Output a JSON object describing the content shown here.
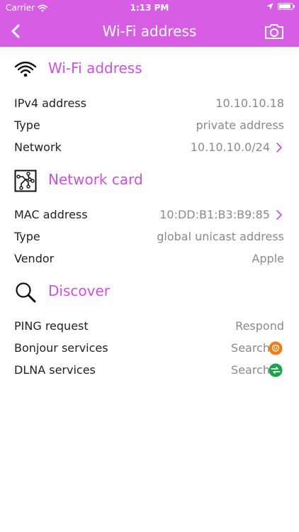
{
  "status_bar": {
    "carrier": "Carrier",
    "time": "1:13 PM",
    "battery_level": 0.9
  },
  "nav": {
    "title": "Wi-Fi address",
    "back_icon": "chevron-left-icon",
    "action_icon": "camera-icon"
  },
  "colors": {
    "bar": "#d75de5",
    "accent": "#cf4fe0",
    "bonjour": "#f07c1a",
    "dlna": "#1aa34a"
  },
  "sections": {
    "wifi": {
      "title": "Wi-Fi address",
      "icon": "wifi-icon",
      "rows": {
        "ipv4": {
          "label": "IPv4 address",
          "value": "10.10.10.18"
        },
        "type": {
          "label": "Type",
          "value": "private address"
        },
        "network": {
          "label": "Network",
          "value": "10.10.10.0/24"
        }
      }
    },
    "card": {
      "title": "Network card",
      "icon": "network-card-icon",
      "rows": {
        "mac": {
          "label": "MAC address",
          "value": "10:DD:B1:B3:B9:85"
        },
        "type": {
          "label": "Type",
          "value": "global unicast address"
        },
        "vendor": {
          "label": "Vendor",
          "value": "Apple"
        }
      }
    },
    "discover": {
      "title": "Discover",
      "icon": "magnifier-icon",
      "rows": {
        "ping": {
          "label": "PING request",
          "value": "Respond"
        },
        "bonjour": {
          "label": "Bonjour services",
          "value": "Search",
          "icon": "bonjour-icon"
        },
        "dlna": {
          "label": "DLNA services",
          "value": "Search",
          "icon": "dlna-icon"
        }
      }
    }
  }
}
